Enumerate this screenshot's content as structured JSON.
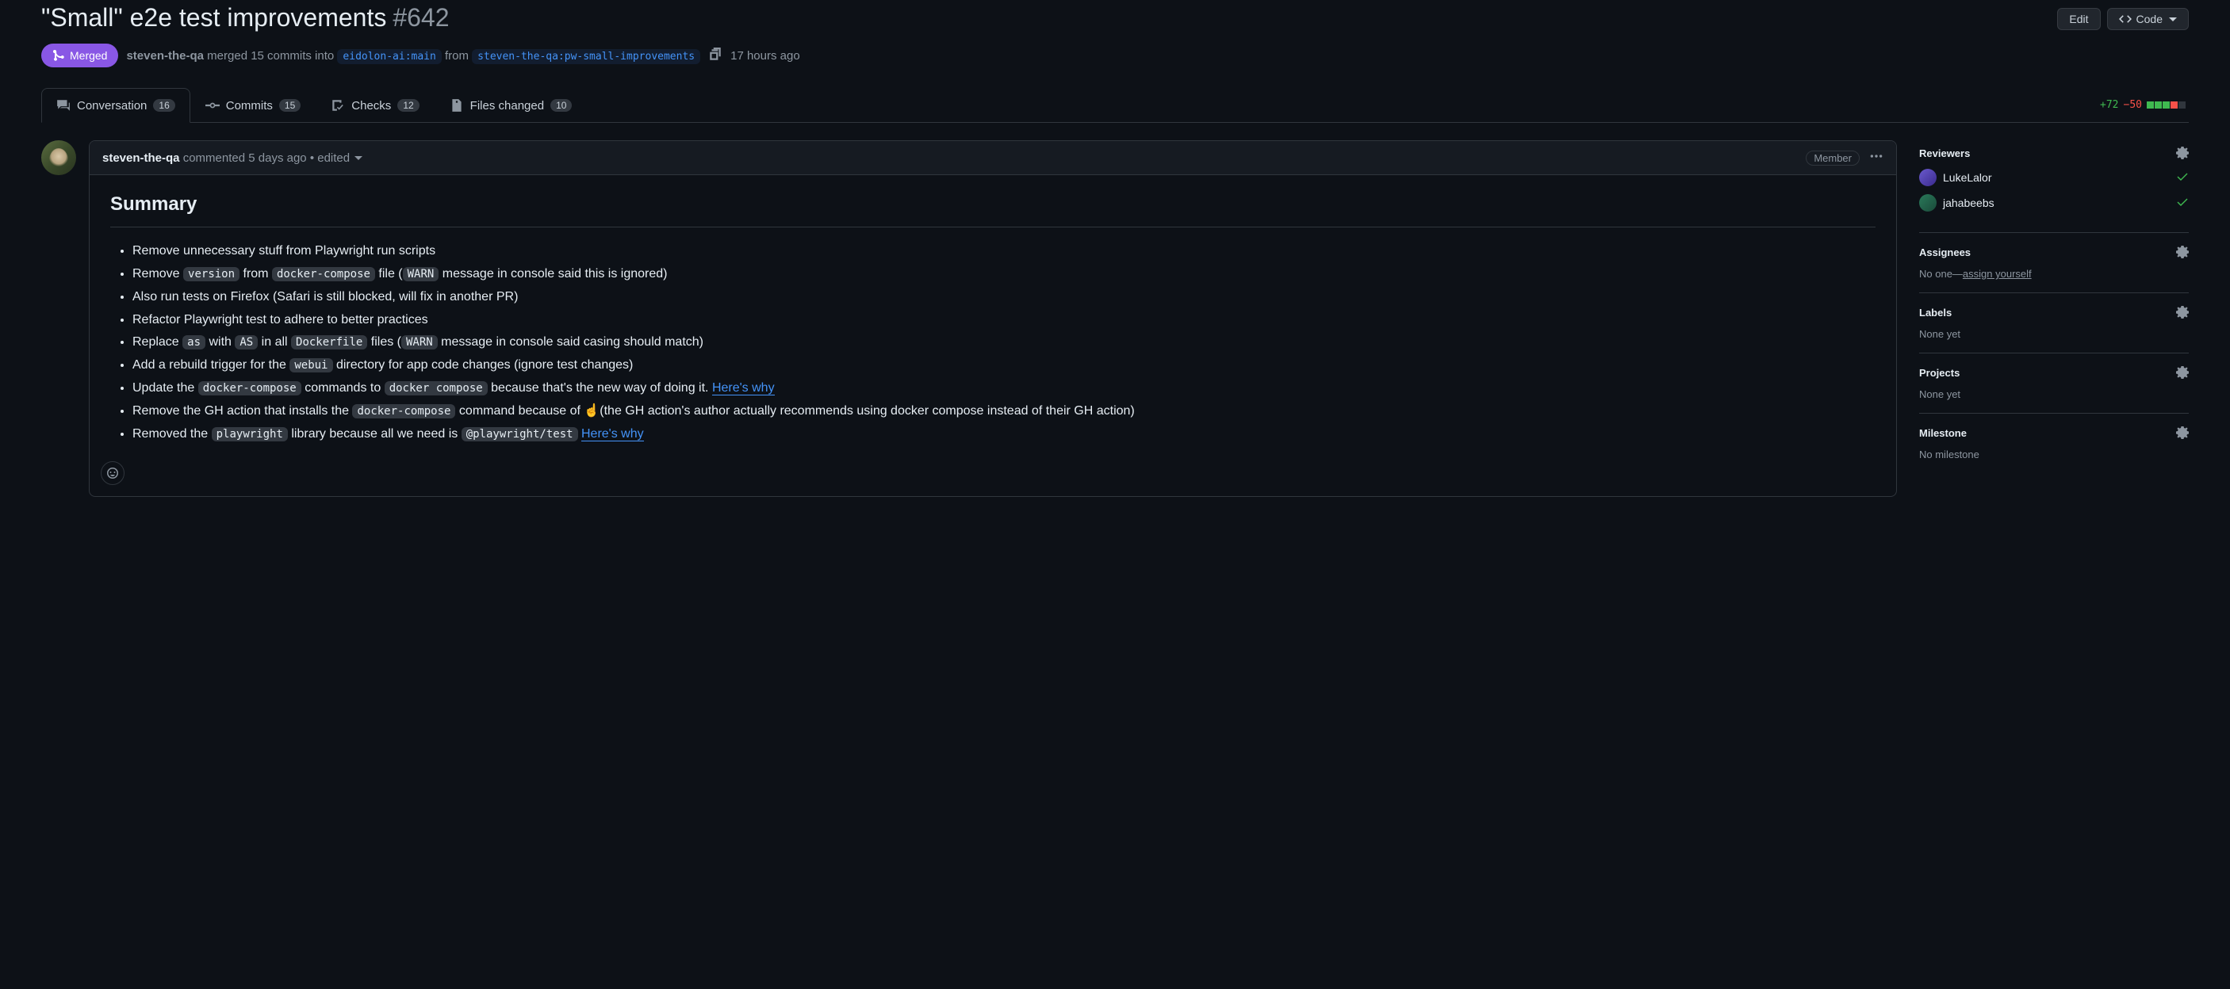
{
  "header": {
    "title": "\"Small\" e2e test improvements",
    "number": "#642",
    "edit_label": "Edit",
    "code_label": "Code"
  },
  "meta": {
    "state": "Merged",
    "author": "steven-the-qa",
    "merged_text_1": "merged 15 commits into",
    "base_ref": "eidolon-ai:main",
    "from_word": "from",
    "head_ref": "steven-the-qa:pw-small-improvements",
    "time_ago": "17 hours ago"
  },
  "tabs": {
    "conversation": {
      "label": "Conversation",
      "count": "16"
    },
    "commits": {
      "label": "Commits",
      "count": "15"
    },
    "checks": {
      "label": "Checks",
      "count": "12"
    },
    "files": {
      "label": "Files changed",
      "count": "10"
    }
  },
  "diffstat": {
    "additions": "+72",
    "deletions": "−50"
  },
  "comment": {
    "author": "steven-the-qa",
    "commented_word": "commented",
    "time": "5 days ago",
    "edited_sep": "•",
    "edited_word": "edited",
    "role": "Member",
    "summary_heading": "Summary",
    "bullets": {
      "b1": "Remove unnecessary stuff from Playwright run scripts",
      "b2_a": "Remove ",
      "b2_code1": "version",
      "b2_b": " from ",
      "b2_code2": "docker-compose",
      "b2_c": " file (",
      "b2_code3": "WARN",
      "b2_d": " message in console said this is ignored)",
      "b3": "Also run tests on Firefox (Safari is still blocked, will fix in another PR)",
      "b4": "Refactor Playwright test to adhere to better practices",
      "b5_a": "Replace ",
      "b5_code1": "as",
      "b5_b": " with ",
      "b5_code2": "AS",
      "b5_c": " in all ",
      "b5_code3": "Dockerfile",
      "b5_d": " files (",
      "b5_code4": "WARN",
      "b5_e": " message in console said casing should match)",
      "b6_a": "Add a rebuild trigger for the ",
      "b6_code1": "webui",
      "b6_b": " directory for app code changes (ignore test changes)",
      "b7_a": "Update the ",
      "b7_code1": "docker-compose",
      "b7_b": " commands to ",
      "b7_code2": "docker compose",
      "b7_c": " because that's the new way of doing it. ",
      "b7_link": "Here's why",
      "b8_a": "Remove the GH action that installs the ",
      "b8_code1": "docker-compose",
      "b8_b": " command because of ☝️(the GH action's author actually recommends using docker compose instead of their GH action)",
      "b9_a": "Removed the ",
      "b9_code1": "playwright",
      "b9_b": " library because all we need is ",
      "b9_code2": "@playwright/test",
      "b9_c": " ",
      "b9_link": "Here's why"
    }
  },
  "sidebar": {
    "reviewers": {
      "title": "Reviewers",
      "items": [
        {
          "name": "LukeLalor"
        },
        {
          "name": "jahabeebs"
        }
      ]
    },
    "assignees": {
      "title": "Assignees",
      "none_prefix": "No one—",
      "assign_link": "assign yourself"
    },
    "labels": {
      "title": "Labels",
      "none": "None yet"
    },
    "projects": {
      "title": "Projects",
      "none": "None yet"
    },
    "milestone": {
      "title": "Milestone",
      "none": "No milestone"
    }
  }
}
